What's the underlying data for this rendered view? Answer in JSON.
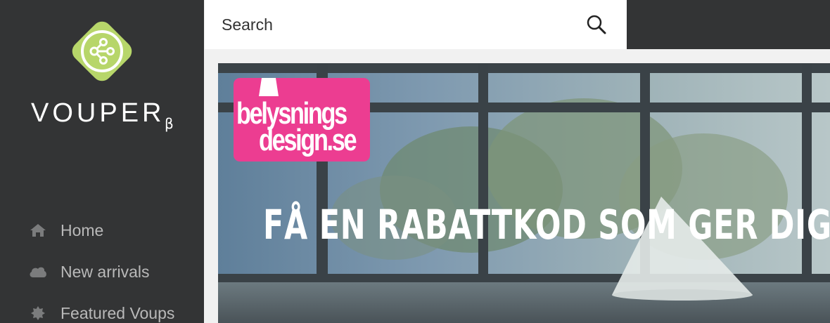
{
  "brand": {
    "name": "VOUPER",
    "superscript": "β",
    "logo_icon": "share-network-icon",
    "logo_color": "#b7d66a"
  },
  "nav": {
    "items": [
      {
        "label": "Home",
        "icon": "home-icon"
      },
      {
        "label": "New arrivals",
        "icon": "cloud-icon"
      },
      {
        "label": "Featured Voups",
        "icon": "badge-icon"
      }
    ]
  },
  "search": {
    "placeholder": "Search",
    "icon": "search-icon"
  },
  "banner": {
    "headline": "FÅ EN RABATTKOD SOM GER DIG",
    "store_logo": {
      "line1": "belysnings",
      "line2": "design.se",
      "color": "#ec3d91"
    }
  },
  "colors": {
    "sidebar": "#333435",
    "page_background": "#f1f1f1",
    "nav_text": "#b9b9b9"
  }
}
